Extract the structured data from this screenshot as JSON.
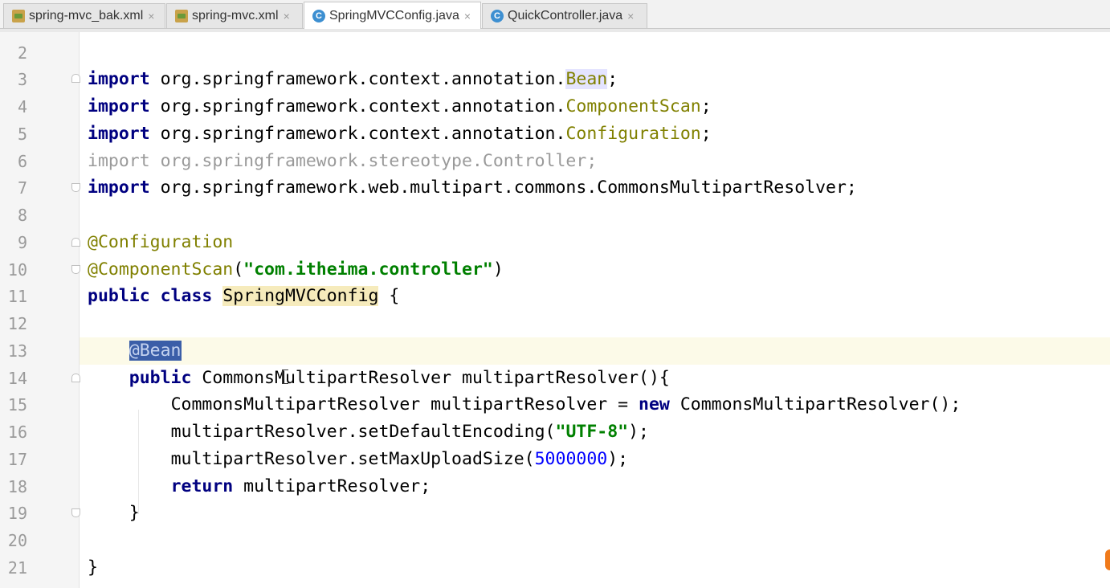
{
  "tabs": [
    {
      "label": "spring-mvc_bak.xml",
      "icon": "xml-file-icon",
      "active": false
    },
    {
      "label": "spring-mvc.xml",
      "icon": "xml-file-icon",
      "active": false
    },
    {
      "label": "SpringMVCConfig.java",
      "icon": "class-file-icon",
      "active": true
    },
    {
      "label": "QuickController.java",
      "icon": "class-file-icon",
      "active": false
    }
  ],
  "close_glyph": "×",
  "line_numbers": [
    "2",
    "3",
    "4",
    "5",
    "6",
    "7",
    "8",
    "9",
    "10",
    "11",
    "12",
    "13",
    "14",
    "15",
    "16",
    "17",
    "18",
    "19",
    "20",
    "21"
  ],
  "code": {
    "l3": {
      "kw": "import",
      "pkg": " org.springframework.context.annotation.",
      "cls": "Bean",
      "end": ";"
    },
    "l4": {
      "kw": "import",
      "pkg": " org.springframework.context.annotation.",
      "cls": "ComponentScan",
      "end": ";"
    },
    "l5": {
      "kw": "import",
      "pkg": " org.springframework.context.annotation.",
      "cls": "Configuration",
      "end": ";"
    },
    "l6": {
      "text": "import org.springframework.stereotype.Controller;"
    },
    "l7": {
      "kw": "import",
      "pkg": " org.springframework.web.multipart.commons.CommonsMultipartResolver;"
    },
    "l9": {
      "ann": "@Configuration"
    },
    "l10": {
      "ann": "@ComponentScan",
      "open": "(",
      "str": "\"com.itheima.controller\"",
      "close": ")"
    },
    "l11": {
      "kw": "public class",
      "space": " ",
      "cls": "SpringMVCConfig",
      "end": " {"
    },
    "l13": {
      "indent": "    ",
      "sel": "@Bean"
    },
    "l14": {
      "indent": "    ",
      "kw": "public",
      "rest": " CommonsMultipartResolver multipartResolver(){"
    },
    "l15": {
      "indent": "        ",
      "a": "CommonsMultipartResolver multipartResolver = ",
      "kw": "new",
      "b": " CommonsMultipartResolver();"
    },
    "l16": {
      "indent": "        ",
      "a": "multipartResolver.setDefaultEncoding(",
      "str": "\"UTF-8\"",
      "b": ");"
    },
    "l17": {
      "indent": "        ",
      "a": "multipartResolver.setMaxUploadSize(",
      "num": "5000000",
      "b": ");"
    },
    "l18": {
      "indent": "        ",
      "kw": "return",
      "rest": " multipartResolver;"
    },
    "l19": {
      "indent": "    ",
      "text": "}"
    },
    "l21": {
      "text": "}"
    }
  },
  "colors": {
    "keyword": "#000080",
    "annotation": "#808000",
    "string": "#008000",
    "number": "#0000ff",
    "selection": "#3b5ea8",
    "current_line": "#fcfae8"
  }
}
